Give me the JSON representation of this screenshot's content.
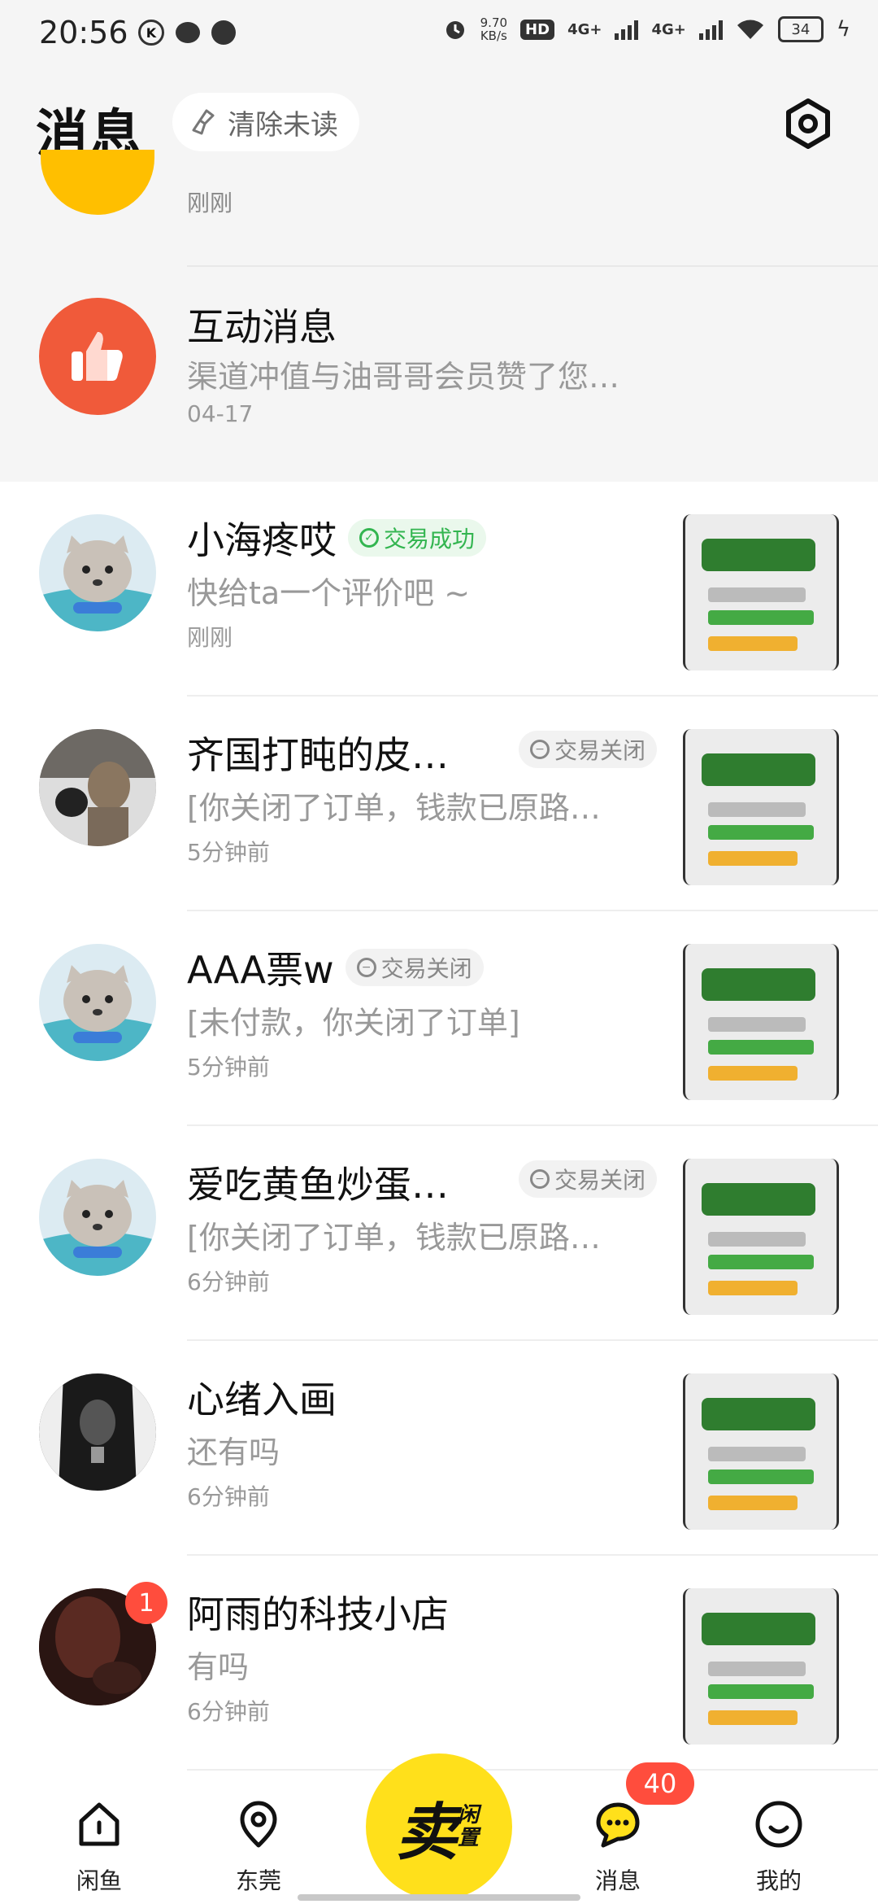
{
  "status_bar": {
    "time": "20:56",
    "net_speed_value": "9.70",
    "net_speed_unit": "KB/s",
    "hd_label": "HD",
    "hd_slots": "1 2",
    "signal_1": "4G+",
    "signal_2": "4G+",
    "battery": "34"
  },
  "header": {
    "title": "消息",
    "clear_unread": "清除未读"
  },
  "top": {
    "first_time": "刚刚",
    "interaction": {
      "title": "互动消息",
      "desc": "渠道冲值与油哥哥会员赞了您…",
      "time": "04-17"
    }
  },
  "conversations": [
    {
      "name": "小海疼哎",
      "status": "交易成功",
      "message": "快给ta一个评价吧 ~",
      "time": "刚刚"
    },
    {
      "name": "齐国打盹的皮…",
      "status": "交易关闭",
      "message": "[你关闭了订单，钱款已原路…",
      "time": "5分钟前"
    },
    {
      "name": "AAA票w",
      "status": "交易关闭",
      "message": "[未付款，你关闭了订单]",
      "time": "5分钟前"
    },
    {
      "name": "爱吃黄鱼炒蛋…",
      "status": "交易关闭",
      "message": "[你关闭了订单，钱款已原路…",
      "time": "6分钟前"
    },
    {
      "name": "心绪入画",
      "status": "",
      "message": "还有吗",
      "time": "6分钟前"
    },
    {
      "name": "阿雨的科技小店",
      "status": "",
      "message": "有吗",
      "time": "6分钟前",
      "unread": "1"
    }
  ],
  "bottom_nav": {
    "home": "闲鱼",
    "location": "东莞",
    "sell_main": "卖",
    "sell_sub": "闲置",
    "messages": "消息",
    "messages_badge": "40",
    "mine": "我的"
  },
  "colors": {
    "accent_yellow": "#ffe01b",
    "badge_red": "#ff4d3d",
    "success_green": "#33b550",
    "interaction_orange": "#f05a3a"
  },
  "icons": [
    "broom-icon",
    "settings-icon",
    "thumbs-up-icon",
    "check-circle-icon",
    "minus-circle-icon",
    "home-icon",
    "location-icon",
    "chat-icon",
    "smile-icon"
  ]
}
